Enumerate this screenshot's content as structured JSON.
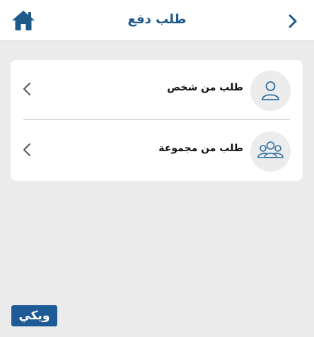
{
  "header": {
    "title": "طلب دفع",
    "home_icon": "home-icon",
    "forward_icon": "chevron-right-icon",
    "accent_color": "#1f5a8a"
  },
  "options": [
    {
      "label": "طلب من شخص",
      "icon": "person-icon"
    },
    {
      "label": "طلب من مجموعة",
      "icon": "group-icon"
    }
  ],
  "watermark": {
    "text": "ويكي"
  }
}
